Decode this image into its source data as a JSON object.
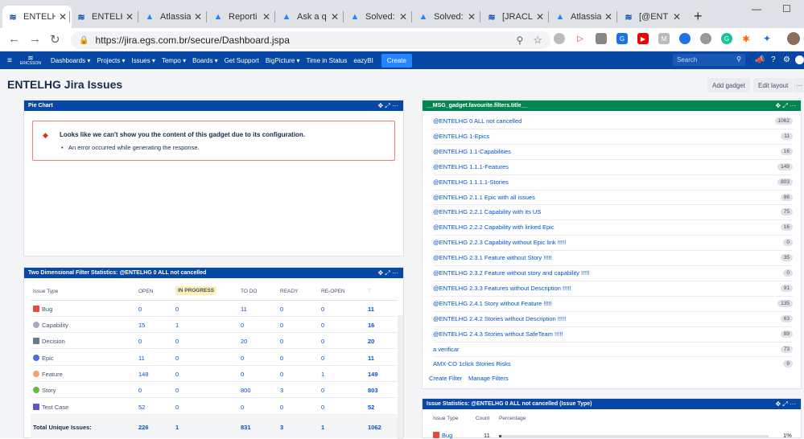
{
  "browser": {
    "tabs": [
      {
        "label": "ENTELH",
        "icon": "jira-icon",
        "active": true
      },
      {
        "label": "ENTELH",
        "icon": "jira-icon"
      },
      {
        "label": "Atlassia",
        "icon": "atlassian-icon"
      },
      {
        "label": "Reporti",
        "icon": "atlassian-icon"
      },
      {
        "label": "Ask a q",
        "icon": "atlassian-icon"
      },
      {
        "label": "Solved:",
        "icon": "atlassian-icon"
      },
      {
        "label": "Solved:",
        "icon": "atlassian-icon"
      },
      {
        "label": "[JRACLO",
        "icon": "jira-icon"
      },
      {
        "label": "Atlassia",
        "icon": "atlassian-icon"
      },
      {
        "label": "[@ENT",
        "icon": "jira-icon"
      }
    ],
    "url": "https://jira.egs.com.br/secure/Dashboard.jspa"
  },
  "nav": {
    "logo": "ERICSSON",
    "items": [
      "Dashboards ▾",
      "Projects ▾",
      "Issues ▾",
      "Tempo ▾",
      "Boards ▾",
      "Get Support",
      "BigPicture ▾",
      "Time in Status",
      "eazyBI"
    ],
    "create": "Create",
    "search_placeholder": "Search"
  },
  "page": {
    "title": "ENTELHG Jira Issues",
    "add_gadget": "Add gadget",
    "edit_layout": "Edit layout",
    "more": "···"
  },
  "pie_gadget": {
    "title": "Pie Chart",
    "error_title": "Looks like we can't show you the content of this gadget due to its configuration.",
    "error_msg": "An error occurred while generating the response."
  },
  "two_dim": {
    "title": "Two Dimensional Filter Statistics: @ENTELHG 0 ALL not cancelled",
    "headers": [
      "Issue Type",
      "OPEN",
      "IN PROGRESS",
      "TO DO",
      "READY",
      "RE-OPEN",
      "T"
    ],
    "rows": [
      {
        "type": "Bug",
        "color": "#e5493a",
        "v": [
          "0",
          "0",
          "11",
          "0",
          "0",
          "11"
        ]
      },
      {
        "type": "Capability",
        "color": "#a5adba",
        "v": [
          "15",
          "1",
          "0",
          "0",
          "0",
          "16"
        ]
      },
      {
        "type": "Decision",
        "color": "#6b778c",
        "v": [
          "0",
          "0",
          "20",
          "0",
          "0",
          "20"
        ]
      },
      {
        "type": "Epic",
        "color": "#4a6ee0",
        "v": [
          "11",
          "0",
          "0",
          "0",
          "0",
          "11"
        ]
      },
      {
        "type": "Feature",
        "color": "#f6a26c",
        "v": [
          "148",
          "0",
          "0",
          "0",
          "1",
          "149"
        ]
      },
      {
        "type": "Story",
        "color": "#63ba3c",
        "v": [
          "0",
          "0",
          "800",
          "3",
          "0",
          "803"
        ]
      },
      {
        "type": "Test Case",
        "color": "#6554c0",
        "v": [
          "52",
          "0",
          "0",
          "0",
          "0",
          "52"
        ]
      }
    ],
    "total_label": "Total Unique Issues:",
    "totals": [
      "226",
      "1",
      "831",
      "3",
      "1",
      "1062"
    ]
  },
  "favourites": {
    "title": "__MSG_gadget.favourite.filters.title__",
    "filters": [
      {
        "name": "@ENTELHG 0 ALL not cancelled",
        "count": "1062"
      },
      {
        "name": "@ENTELHG 1-Epics",
        "count": "11"
      },
      {
        "name": "@ENTELHG 1.1-Capabilities",
        "count": "16"
      },
      {
        "name": "@ENTELHG 1.1.1-Features",
        "count": "149"
      },
      {
        "name": "@ENTELHG 1.1.1.1-Stories",
        "count": "803"
      },
      {
        "name": "@ENTELHG 2.1.1 Epic with all issues",
        "count": "86"
      },
      {
        "name": "@ENTELHG 2.2.1 Capability with its US",
        "count": "75"
      },
      {
        "name": "@ENTELHG 2.2.2 Capability with linked Epic",
        "count": "16"
      },
      {
        "name": "@ENTELHG 2.2.3 Capability without Epic link !!!!!",
        "count": "0"
      },
      {
        "name": "@ENTELHG 2.3.1 Feature without Story !!!!!",
        "count": "35"
      },
      {
        "name": "@ENTELHG 2.3.2 Feature without story and capability !!!!!",
        "count": "0"
      },
      {
        "name": "@ENTELHG 2.3.3 Features without Description !!!!!",
        "count": "91"
      },
      {
        "name": "@ENTELHG 2.4.1 Story without Feature !!!!!",
        "count": "135"
      },
      {
        "name": "@ENTELHG 2.4.2 Stories without Description !!!!!",
        "count": "63"
      },
      {
        "name": "@ENTELHG 2.4.3 Stories without SafeTeam !!!!!",
        "count": "89"
      },
      {
        "name": "a verificar",
        "count": "73"
      },
      {
        "name": "AMX-CO 1click Stories Risks",
        "count": "9"
      }
    ],
    "create_filter": "Create Filter",
    "manage_filters": "Manage Filters"
  },
  "issue_stats": {
    "title": "Issue Statistics: @ENTELHG 0 ALL not cancelled (Issue Type)",
    "headers": [
      "Issue Type",
      "Count",
      "Percentage"
    ],
    "rows": [
      {
        "type": "Bug",
        "count": "11",
        "pct": "1%",
        "fraction": 0.01
      }
    ]
  },
  "colors": {
    "nav": "#0747a6",
    "pie_header": "#0747a6",
    "fav_header": "#008751",
    "tds_header": "#0747a6",
    "is_header": "#0747a6"
  }
}
